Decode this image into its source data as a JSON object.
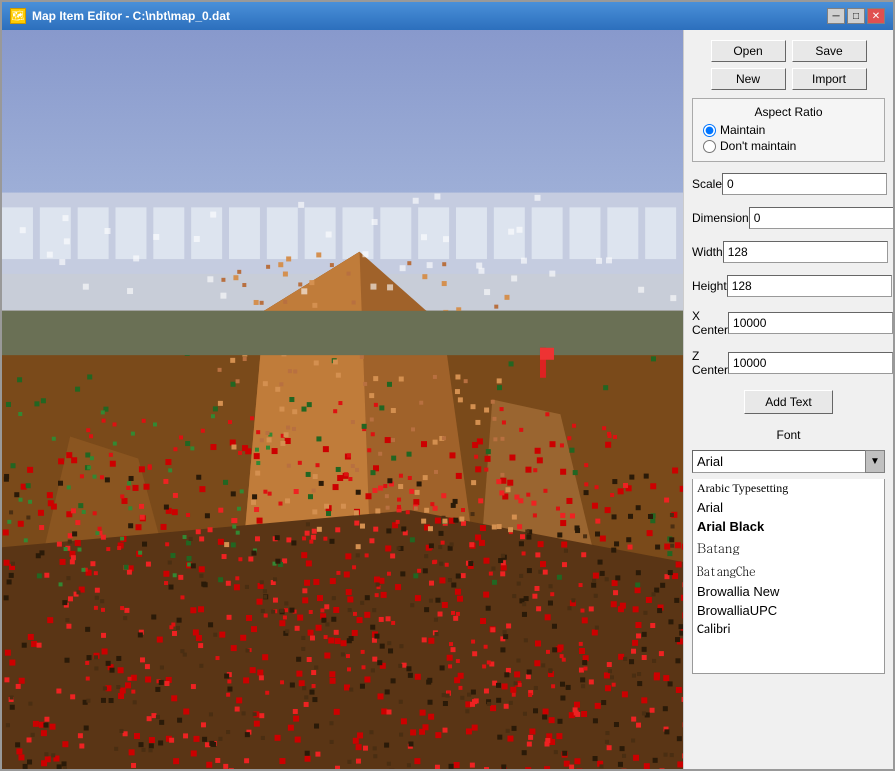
{
  "window": {
    "title": "Map Item Editor - C:\\nbt\\map_0.dat",
    "icon": "map-icon"
  },
  "titlebar": {
    "minimize_label": "─",
    "maximize_label": "□",
    "close_label": "✕"
  },
  "buttons": {
    "open": "Open",
    "save": "Save",
    "new": "New",
    "import": "Import",
    "add_text": "Add Text"
  },
  "aspect_ratio": {
    "title": "Aspect Ratio",
    "maintain_label": "Maintain",
    "dont_maintain_label": "Don't maintain",
    "selected": "maintain"
  },
  "fields": {
    "scale": {
      "label": "Scale",
      "value": "0"
    },
    "dimension": {
      "label": "Dimension",
      "value": "0"
    },
    "width": {
      "label": "Width",
      "value": "128"
    },
    "height": {
      "label": "Height",
      "value": "128"
    },
    "x_center": {
      "label": "X Center",
      "value": "10000"
    },
    "z_center": {
      "label": "Z Center",
      "value": "10000"
    }
  },
  "font": {
    "label": "Font",
    "selected": "Arial",
    "list": [
      {
        "name": "Arabic Typesetting",
        "style": "normal"
      },
      {
        "name": "Arial",
        "style": "normal"
      },
      {
        "name": "Arial Black",
        "style": "bold"
      },
      {
        "name": "Batang",
        "style": "normal"
      },
      {
        "name": "BatangChe",
        "style": "normal"
      },
      {
        "name": "Browallia New",
        "style": "normal"
      },
      {
        "name": "BrowalliaUPC",
        "style": "normal"
      },
      {
        "name": "Calibri",
        "style": "normal"
      }
    ]
  }
}
